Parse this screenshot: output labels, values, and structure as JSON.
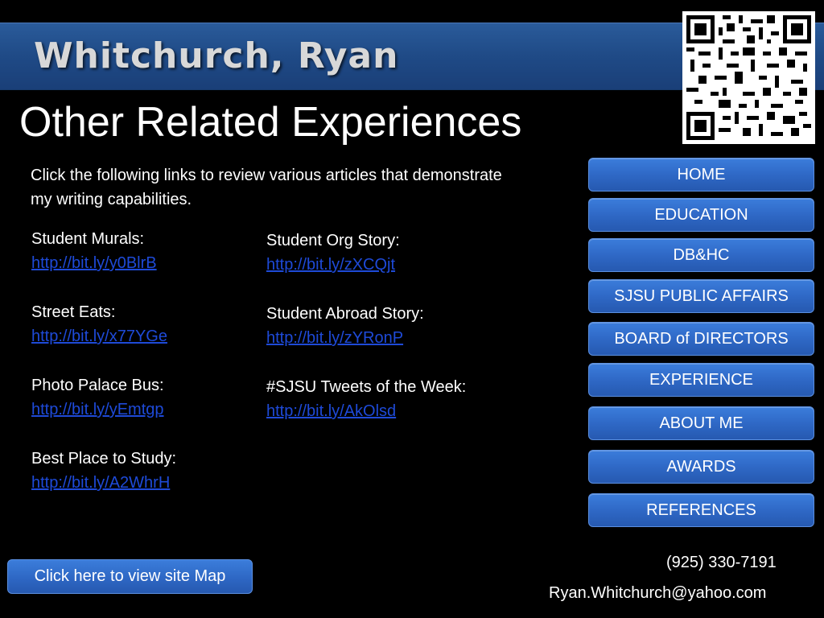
{
  "header": {
    "name": "Whitchurch, Ryan",
    "page_title": "Other Related Experiences",
    "qr_icon": "qr-code-icon"
  },
  "intro": "Click the following links to review various articles that demonstrate my writing capabilities.",
  "articles_left": [
    {
      "label": "Student Murals:",
      "url": "http://bit.ly/y0BlrB"
    },
    {
      "label": "Street Eats:",
      "url": "http://bit.ly/x77YGe"
    },
    {
      "label": "Photo Palace Bus:",
      "url": "http://bit.ly/yEmtgp"
    },
    {
      "label": "Best Place to Study:",
      "url": "http://bit.ly/A2WhrH"
    }
  ],
  "articles_right": [
    {
      "label": "Student Org Story:",
      "url": "http://bit.ly/zXCQjt"
    },
    {
      "label": "Student Abroad Story:",
      "url": "http://bit.ly/zYRonP"
    },
    {
      "label": "#SJSU Tweets of the Week:",
      "url": "http://bit.ly/AkOlsd"
    }
  ],
  "nav": {
    "items": [
      {
        "label": "HOME"
      },
      {
        "label": "EDUCATION"
      },
      {
        "label": "DB&HC"
      },
      {
        "label": "SJSU PUBLIC AFFAIRS"
      },
      {
        "label": "BOARD of DIRECTORS"
      },
      {
        "label": "EXPERIENCE"
      },
      {
        "label": "ABOUT ME"
      },
      {
        "label": "AWARDS"
      },
      {
        "label": "REFERENCES"
      }
    ]
  },
  "footer": {
    "sitemap_label": "Click here to view site Map",
    "phone": "(925) 330-7191",
    "email": "Ryan.Whitchurch@yahoo.com"
  },
  "colors": {
    "banner": "#1f4a86",
    "button": "#2e67c4",
    "link": "#1e4ad8",
    "background": "#000000"
  }
}
